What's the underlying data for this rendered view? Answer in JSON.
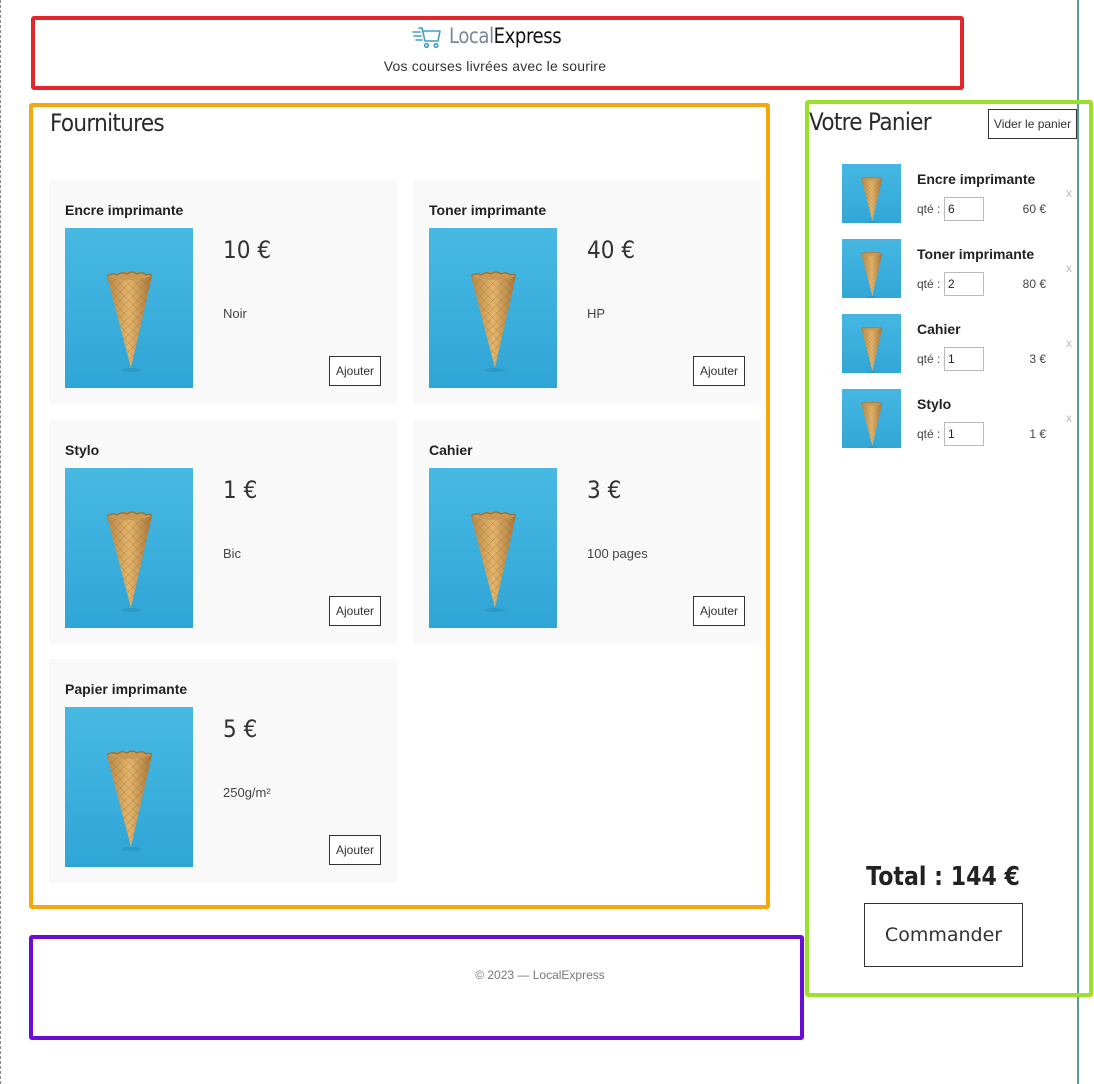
{
  "header": {
    "logo_local": "Local",
    "logo_express": "Express",
    "tagline": "Vos courses livrées avec le sourire"
  },
  "catalog": {
    "title": "Fournitures",
    "add_label": "Ajouter",
    "products": [
      {
        "name": "Encre imprimante",
        "price": "10 €",
        "desc": "Noir"
      },
      {
        "name": "Toner imprimante",
        "price": "40 €",
        "desc": "HP"
      },
      {
        "name": "Stylo",
        "price": "1 €",
        "desc": "Bic"
      },
      {
        "name": "Cahier",
        "price": "3 €",
        "desc": "100 pages"
      },
      {
        "name": "Papier imprimante",
        "price": "5 €",
        "desc": "250g/m²"
      }
    ]
  },
  "cart": {
    "title": "Votre Panier",
    "clear_label": "Vider le panier",
    "qty_label": "qté :",
    "remove_label": "x",
    "items": [
      {
        "name": "Encre imprimante",
        "qty": "6",
        "total": "60 €"
      },
      {
        "name": "Toner imprimante",
        "qty": "2",
        "total": "80 €"
      },
      {
        "name": "Cahier",
        "qty": "1",
        "total": "3 €"
      },
      {
        "name": "Stylo",
        "qty": "1",
        "total": "1 €"
      }
    ],
    "total_text": "Total : 144 €",
    "order_label": "Commander"
  },
  "footer": {
    "copyright": "© 2023 — LocalExpress"
  },
  "colors": {
    "highlight_red": "#e2262a",
    "highlight_orange": "#f4a70e",
    "highlight_green": "#9be12b",
    "highlight_purple": "#6a0bd6",
    "image_background": "#3fb3de",
    "card_background": "#f9f9f9"
  },
  "icons": {
    "logo": "shopping-cart-icon",
    "product_image": "ice-cream-cone-photo"
  }
}
